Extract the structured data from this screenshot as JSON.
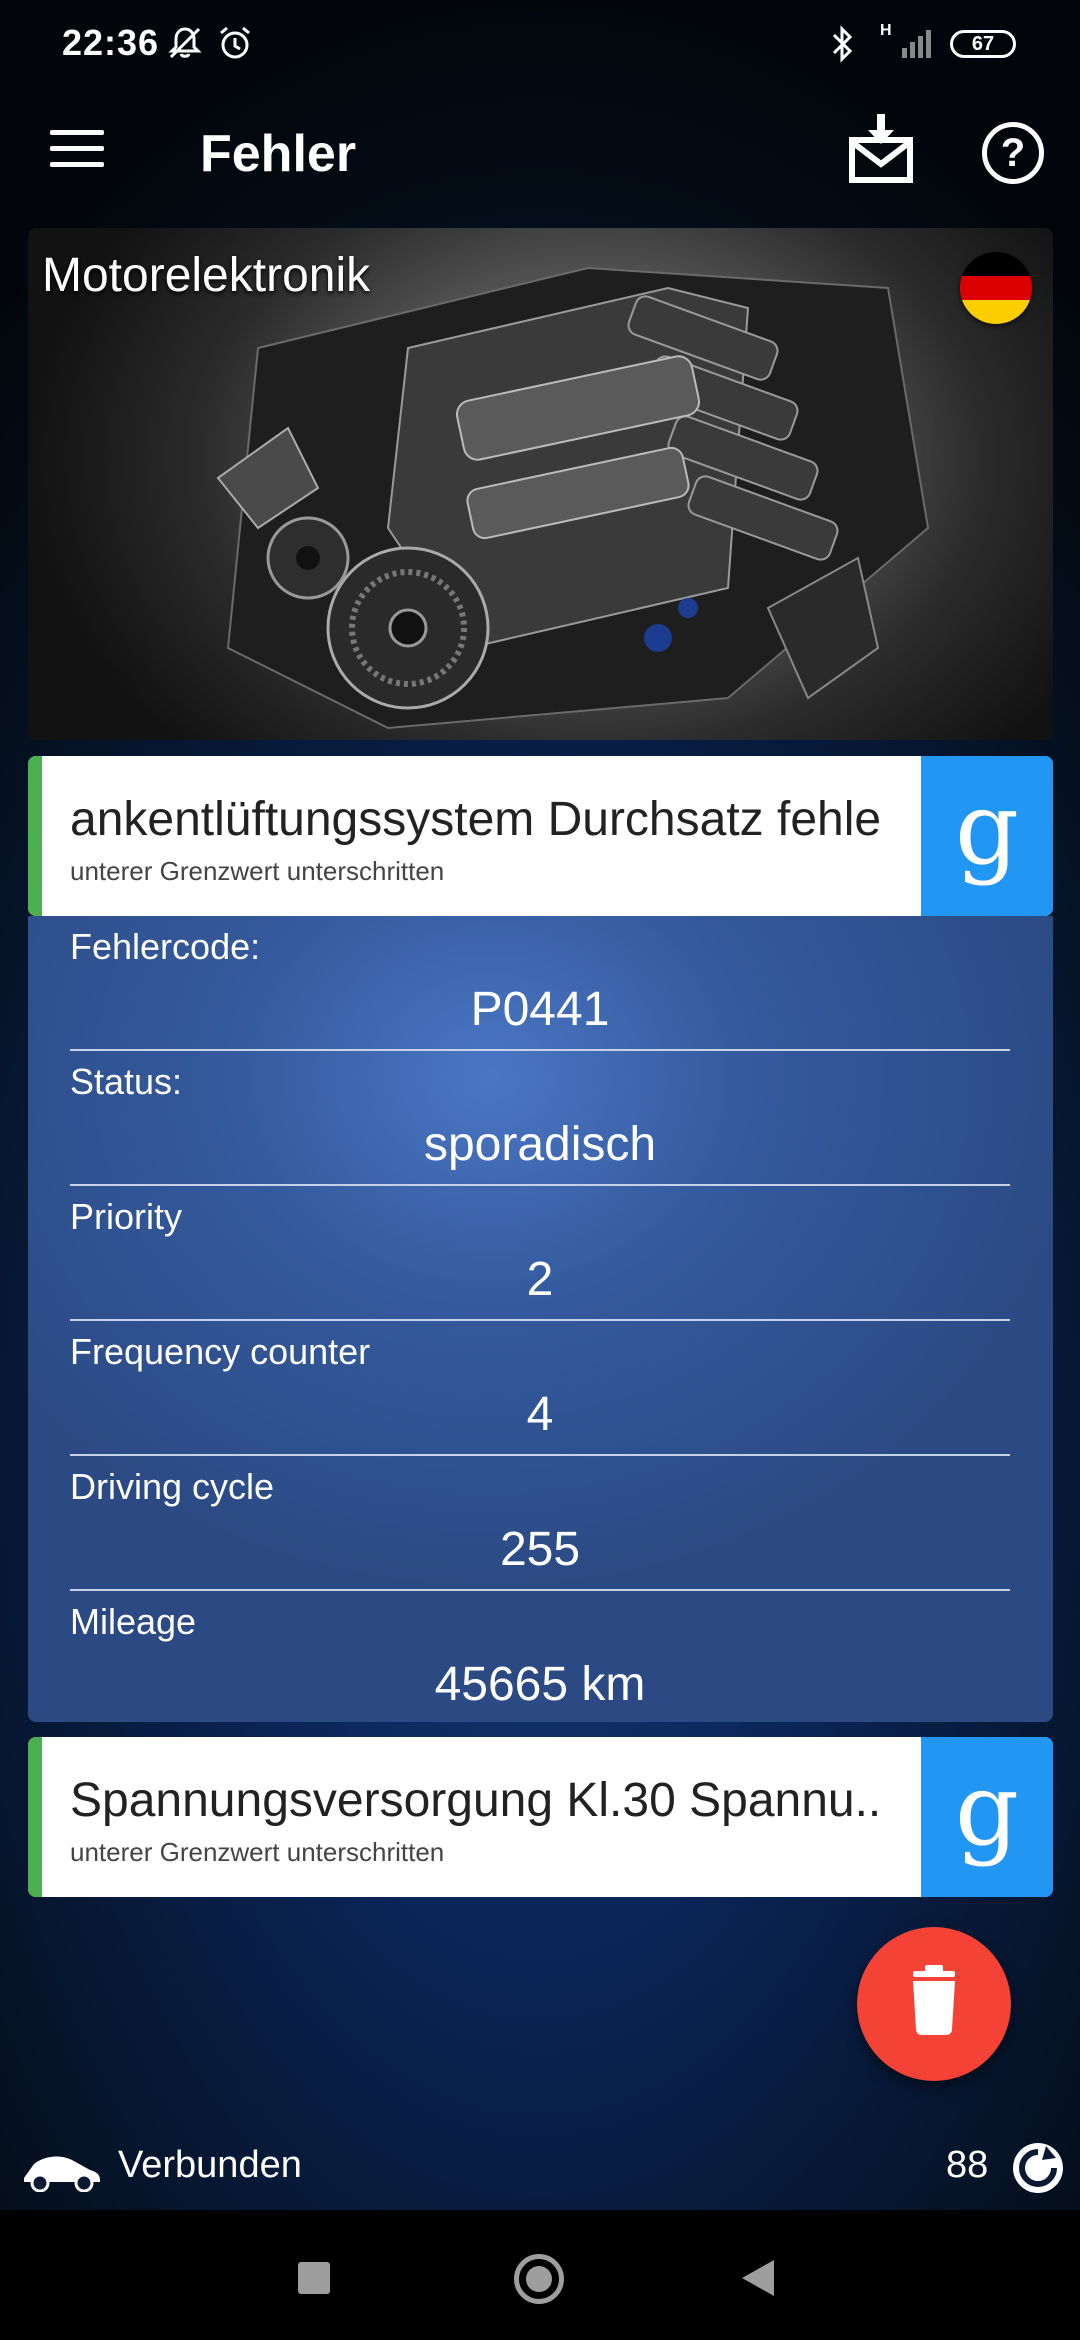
{
  "status_bar": {
    "time": "22:36",
    "battery": "67",
    "network": "H"
  },
  "app_bar": {
    "title": "Fehler",
    "menu_icon": "hamburger-menu-icon",
    "download_icon": "inbox-download-icon",
    "help_icon": "help-icon"
  },
  "module": {
    "name": "Motorelektronik",
    "flag": "germany-flag-icon"
  },
  "faults": [
    {
      "title": "Tankentlüftungssystem Durchsatz fehlerhaft",
      "title_visible": "ankentlüftungssystem Durchsatz fehle",
      "subtitle": "unterer Grenzwert unterschritten",
      "search_label": "g",
      "expanded": true,
      "details": [
        {
          "label": "Fehlercode:",
          "value": "P0441"
        },
        {
          "label": "Status:",
          "value": "sporadisch"
        },
        {
          "label": "Priority",
          "value": "2"
        },
        {
          "label": "Frequency counter",
          "value": "4"
        },
        {
          "label": "Driving cycle",
          "value": "255"
        },
        {
          "label": "Mileage",
          "value": "45665 km"
        }
      ]
    },
    {
      "title": "Spannungsversorgung Kl.30 Spannu..",
      "subtitle": "unterer Grenzwert unterschritten",
      "search_label": "g",
      "expanded": false
    }
  ],
  "fab": {
    "icon": "trash-icon"
  },
  "connection": {
    "status": "Verbunden",
    "count": "88",
    "car_icon": "car-icon",
    "refresh_icon": "refresh-icon"
  },
  "colors": {
    "accent_green": "#4caf50",
    "google_blue": "#2196f3",
    "delete_red": "#f44336",
    "panel_blue": "#34599c"
  }
}
